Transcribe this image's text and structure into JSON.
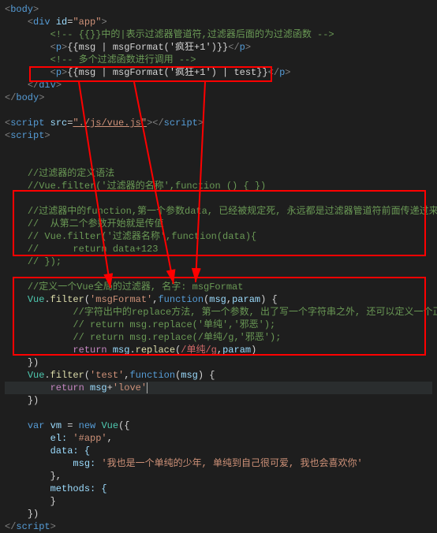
{
  "code": {
    "l1": "<body>",
    "l2_open": "<div ",
    "l2_attr": "id",
    "l2_eq": "=",
    "l2_val": "\"app\"",
    "l2_close": ">",
    "l3": "<!-- {{}}中的|表示过滤器管道符,过滤器后面的为过滤函数 -->",
    "l4_a": "<p>",
    "l4_b": "{{msg | msgFormat('疯狂+1')}}",
    "l4_c": "</p>",
    "l5": "<!-- 多个过滤函数进行调用 -->",
    "l6_a": "<p>",
    "l6_b": "{{msg | msgFormat('疯狂+1') | test}}",
    "l6_c": "</p>",
    "l7": "</div>",
    "l8": "</body>",
    "l9_a": "<script ",
    "l9_attr": "src",
    "l9_eq": "=",
    "l9_val": "\"./js/vue.js\"",
    "l9_b": "></",
    "l9_c": "script",
    "l9_d": ">",
    "l10_a": "<",
    "l10_b": "script",
    "l10_c": ">",
    "c1": "//过滤器的定义语法",
    "c2": "//Vue.filter('过滤器的名称',function () { })",
    "c3": "//过滤器中的function,第一个参数data, 已经被规定死, 永远都是过滤器管道符前面传递过来的数据",
    "c4": "//  从第二个参数开始就是传值",
    "c5": "// Vue.filter('过滤器名称',function(data){",
    "c6": "//      return data+123",
    "c7": "// });",
    "c8": "//定义一个Vue全局的过滤器, 名字: msgFormat",
    "f1_a": "Vue",
    "f1_b": ".filter(",
    "f1_c": "'msgFormat'",
    "f1_d": ",",
    "f1_e": "function",
    "f1_f": "(",
    "f1_g": "msg",
    "f1_h": ",",
    "f1_i": "param",
    "f1_j": ") {",
    "c9": "//字符出中的replace方法, 第一个参数, 出了写一个字符串之外, 还可以定义一个正则",
    "c10": "// return msg.replace('单纯','邪恶');",
    "c11": "// return msg.replace(/单纯/g,'邪恶');",
    "r1_a": "return ",
    "r1_b": "msg",
    "r1_c": ".replace(",
    "r1_d": "/单纯/g",
    "r1_e": ",",
    "r1_f": "param",
    "r1_g": ")",
    "close1": "})",
    "f2_a": "Vue",
    "f2_b": ".filter(",
    "f2_c": "'test'",
    "f2_d": ",",
    "f2_e": "function",
    "f2_f": "(",
    "f2_g": "msg",
    "f2_h": ") {",
    "r2_a": "return ",
    "r2_b": "msg",
    "r2_c": "+",
    "r2_d": "'love'",
    "close2": "})",
    "v1_a": "var ",
    "v1_b": "vm",
    "v1_c": " = ",
    "v1_d": "new ",
    "v1_e": "Vue",
    "v1_f": "({",
    "p1_a": "el: ",
    "p1_b": "'#app'",
    "p1_c": ",",
    "p2_a": "data: {",
    "p3_a": "msg: ",
    "p3_b": "'我也是一个单纯的少年, 单纯到自己很可爱, 我也会喜欢你'",
    "p4": "},",
    "p5_a": "methods: {",
    "p6": "}",
    "close3": "})",
    "l_end_a": "</",
    "l_end_b": "script",
    "l_end_c": ">"
  }
}
